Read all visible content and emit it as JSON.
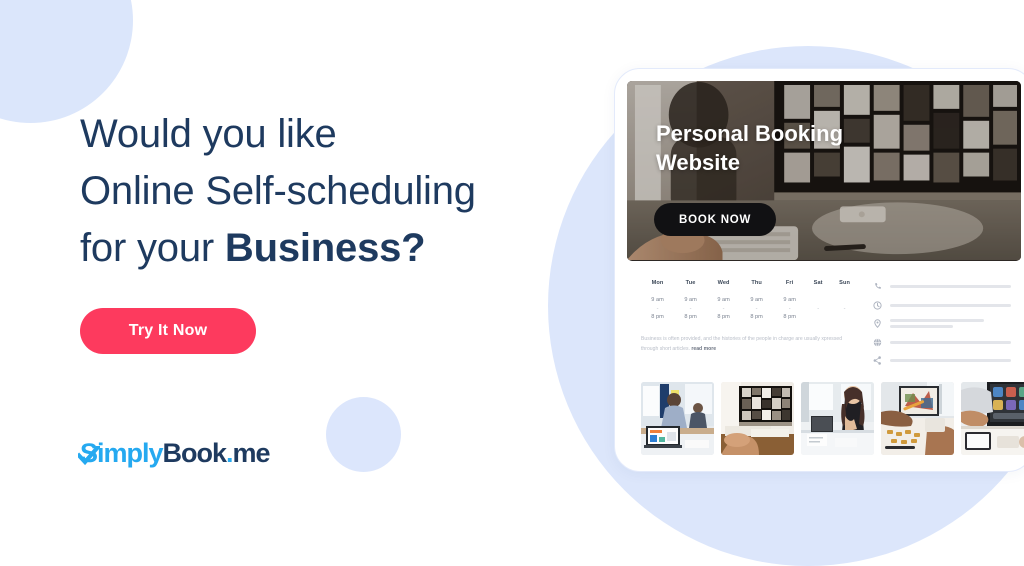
{
  "theme": {
    "navy": "#1e3a5f",
    "cta_pink": "#fd3a5e",
    "logo_blue": "#25a9f0",
    "blob_blue": "#dce6fb"
  },
  "left": {
    "headline_line1": "Would you like",
    "headline_line2": "Online Self-scheduling",
    "headline_line3_prefix": "for your ",
    "headline_line3_bold": "Business?",
    "cta_label": "Try It Now"
  },
  "logo": {
    "simply": "Simply",
    "book": "Book",
    "dot": ".",
    "me": "me",
    "check_icon": "check-icon"
  },
  "mockup": {
    "hero": {
      "title_line1": "Personal Booking",
      "title_line2": "Website",
      "book_now_label": "BOOK NOW"
    },
    "schedule": {
      "days": [
        "Mon",
        "Tue",
        "Wed",
        "Thu",
        "Fri",
        "Sat",
        "Sun"
      ],
      "open": [
        "9 am",
        "9 am",
        "9 am",
        "9 am",
        "9 am",
        "",
        ""
      ],
      "separator": [
        "-",
        "-",
        "-",
        "-",
        "-",
        "-",
        "-"
      ],
      "close": [
        "8 pm",
        "8 pm",
        "8 pm",
        "8 pm",
        "8 pm",
        "",
        ""
      ]
    },
    "about": {
      "text": "Business is often provided, and the histories of the people in charge are usually xpressed through short articles. ",
      "read_more": "read more"
    },
    "contacts": [
      {
        "icon": "phone-icon",
        "lines": 1
      },
      {
        "icon": "clock-icon",
        "lines": 1
      },
      {
        "icon": "location-pin-icon",
        "lines": 2
      },
      {
        "icon": "globe-icon",
        "lines": 1
      },
      {
        "icon": "share-icon",
        "lines": 1
      }
    ],
    "gallery": [
      {
        "name": "gallery-photo-1"
      },
      {
        "name": "gallery-photo-2"
      },
      {
        "name": "gallery-photo-3"
      },
      {
        "name": "gallery-photo-4"
      },
      {
        "name": "gallery-photo-5"
      }
    ]
  }
}
